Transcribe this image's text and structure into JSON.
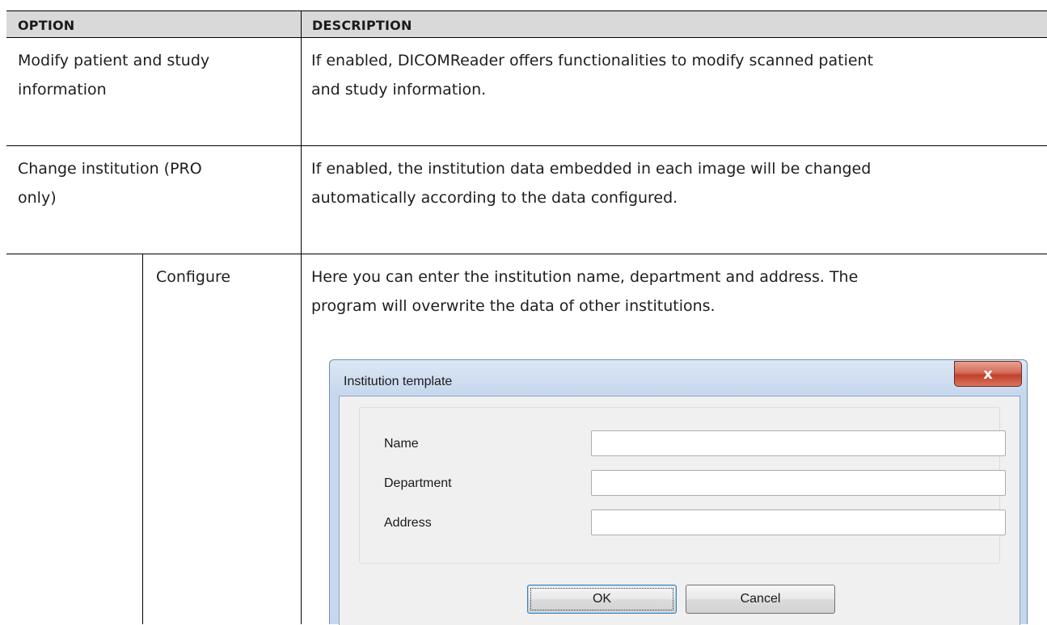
{
  "table": {
    "headers": [
      "OPTION",
      "DESCRIPTION"
    ],
    "rows": [
      {
        "option_lines": [
          "Modify patient and study",
          "information"
        ],
        "description_lines": [
          "If enabled, DICOMReader offers functionalities to modify scanned patient",
          "and study information."
        ]
      },
      {
        "option_lines": [
          "Change institution (PRO",
          "only)"
        ],
        "description_lines": [
          "If enabled, the institution data embedded in each image will be changed",
          "automatically according to the data configured."
        ]
      },
      {
        "sub_option": "Configure",
        "description_lines": [
          "Here you can enter the institution name, department and address. The",
          "program will overwrite the data of other institutions."
        ]
      }
    ]
  },
  "dialog": {
    "title": "Institution template",
    "close_glyph": "x",
    "fields": [
      {
        "label": "Name",
        "value": ""
      },
      {
        "label": "Department",
        "value": ""
      },
      {
        "label": "Address",
        "value": ""
      }
    ],
    "ok_label": "OK",
    "cancel_label": "Cancel"
  }
}
